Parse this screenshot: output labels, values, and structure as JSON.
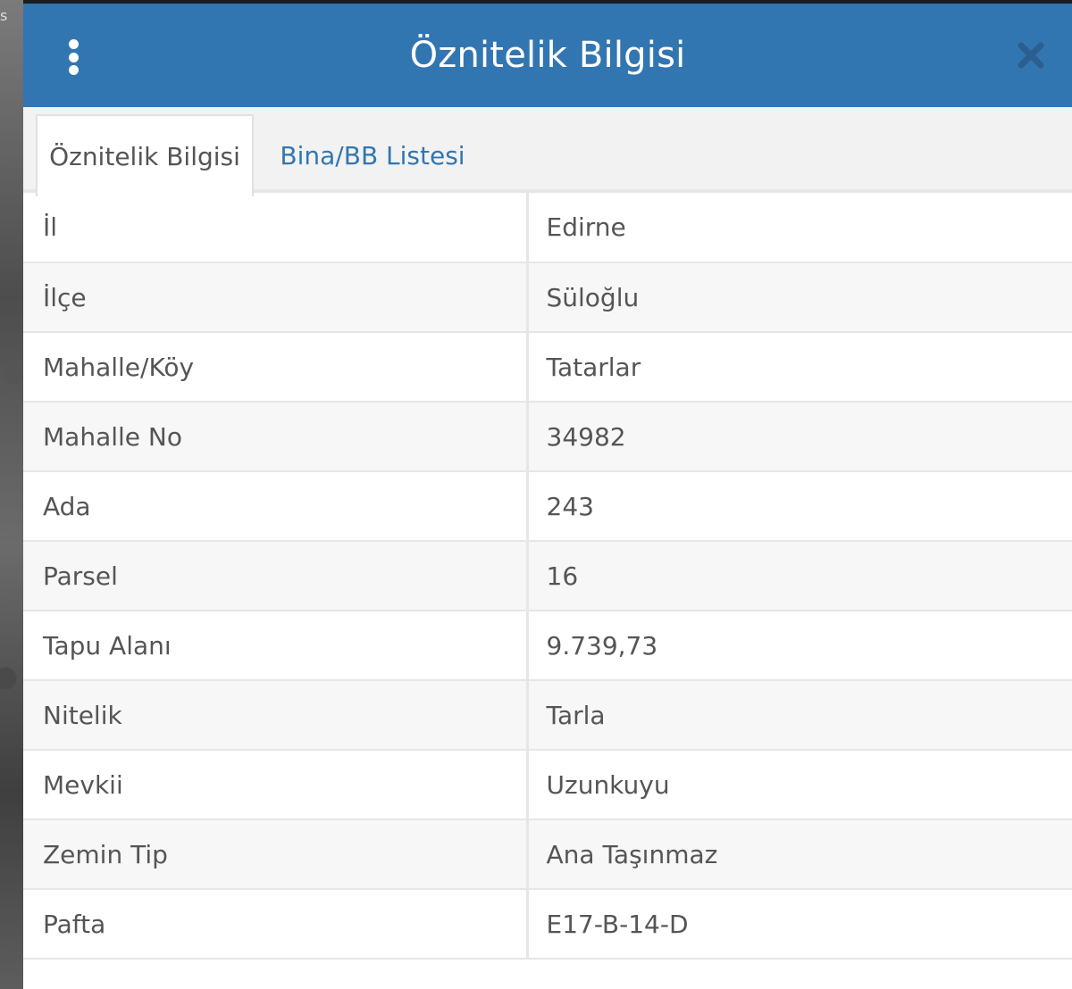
{
  "panel": {
    "title": "Öznitelik Bilgisi",
    "menu_icon": "vertical-ellipsis-icon",
    "close_icon": "close-icon",
    "header_color": "#3276b1"
  },
  "tabs": [
    {
      "label": "Öznitelik Bilgisi",
      "active": true
    },
    {
      "label": "Bina/BB Listesi",
      "active": false
    }
  ],
  "attributes": [
    {
      "key": "İl",
      "value": "Edirne"
    },
    {
      "key": "İlçe",
      "value": "Süloğlu"
    },
    {
      "key": "Mahalle/Köy",
      "value": "Tatarlar"
    },
    {
      "key": "Mahalle No",
      "value": "34982"
    },
    {
      "key": "Ada",
      "value": "243"
    },
    {
      "key": "Parsel",
      "value": "16"
    },
    {
      "key": "Tapu Alanı",
      "value": "9.739,73"
    },
    {
      "key": "Nitelik",
      "value": "Tarla"
    },
    {
      "key": "Mevkii",
      "value": "Uzunkuyu"
    },
    {
      "key": "Zemin Tip",
      "value": "Ana Taşınmaz"
    },
    {
      "key": "Pafta",
      "value": "E17-B-14-D"
    }
  ],
  "map_corner_text": "s"
}
